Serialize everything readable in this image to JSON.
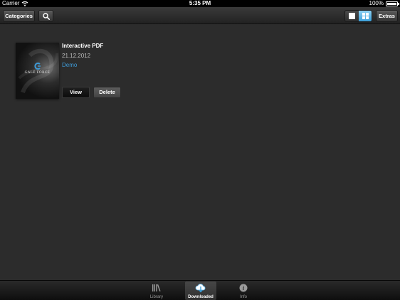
{
  "status_bar": {
    "carrier": "Carrier",
    "time": "5:35 PM",
    "battery_text": "100%",
    "battery_level": 1.0
  },
  "toolbar": {
    "categories_label": "Categories",
    "search_icon": "search-icon",
    "view_single_icon": "single-view-icon",
    "view_grid_icon": "grid-view-icon",
    "active_view": "grid",
    "extras_label": "Extras"
  },
  "items": [
    {
      "title": "Interactive PDF",
      "date": "21.12.2012",
      "category": "Demo",
      "cover_brand": "GALE FORCE",
      "view_label": "View",
      "delete_label": "Delete"
    }
  ],
  "tabbar": {
    "tabs": [
      {
        "label": "Library",
        "icon": "library-icon",
        "selected": false
      },
      {
        "label": "Downloaded",
        "icon": "cloud-download-icon",
        "selected": true
      },
      {
        "label": "Info",
        "icon": "info-icon",
        "selected": false
      }
    ]
  },
  "colors": {
    "background": "#2c2c2c",
    "link_accent": "#3e9ad6",
    "grid_toggle_active": "#3c9fd9"
  }
}
